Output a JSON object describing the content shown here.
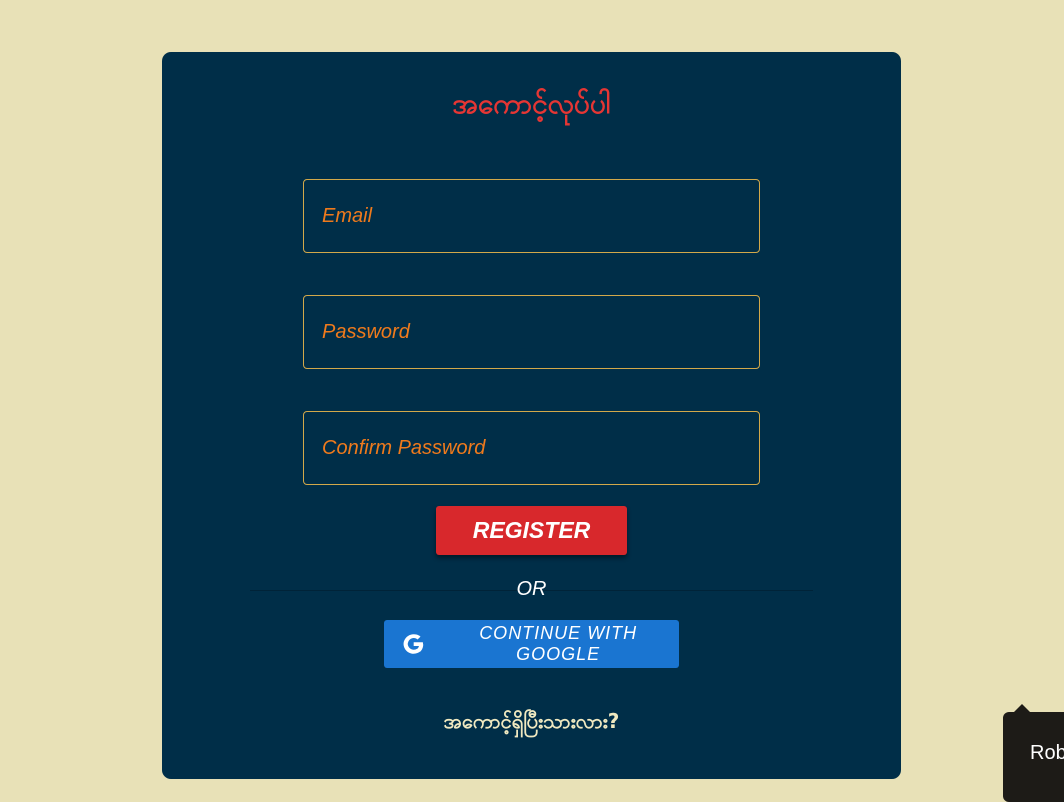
{
  "form": {
    "title": "အကောင့်လုပ်ပါ",
    "email_placeholder": "Email",
    "password_placeholder": "Password",
    "confirm_password_placeholder": "Confirm Password",
    "register_label": "REGISTER",
    "or_label": "OR",
    "google_label": "CONTINUE WITH GOOGLE",
    "login_prompt": "အကောင့်ရှိပြီးသားလား?"
  },
  "chat_widget": {
    "label": "Rob"
  },
  "colors": {
    "page_background": "#e8e1b7",
    "card_background": "#002e48",
    "title": "#e53634",
    "placeholder": "#ef7a1c",
    "field_border": "#d2a84a",
    "register_button": "#d8282c",
    "google_button": "#1a75d1"
  },
  "icons": {
    "google": "google-g-icon"
  }
}
